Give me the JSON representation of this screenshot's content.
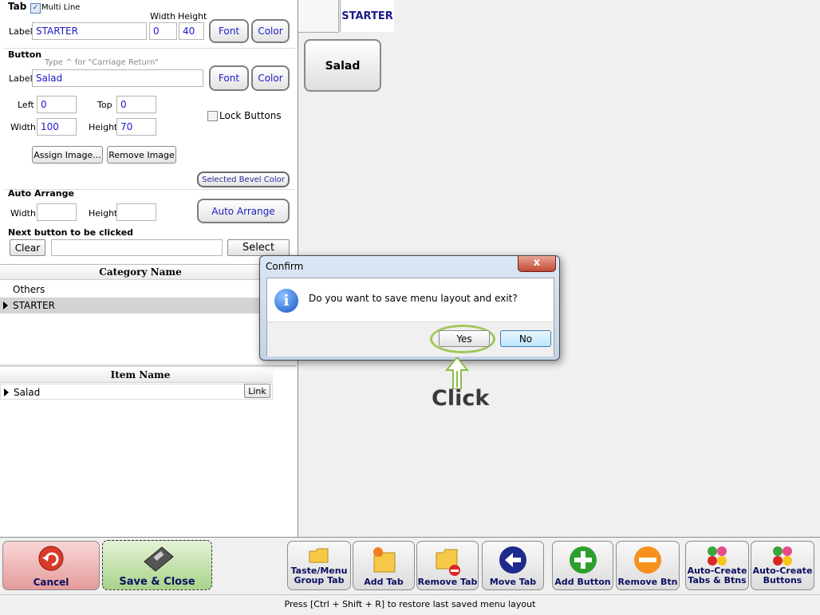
{
  "tab_section": {
    "heading": "Tab",
    "multiline_label": "Multi Line",
    "multiline_checked": true,
    "width_header": "Width",
    "height_header": "Height",
    "label_caption": "Label",
    "label_value": "STARTER",
    "width_value": "0",
    "height_value": "40",
    "font_btn": "Font",
    "color_btn": "Color"
  },
  "button_section": {
    "heading": "Button",
    "hint": "Type ^ for \"Carriage Return\"",
    "label_caption": "Label",
    "label_value": "Salad",
    "font_btn": "Font",
    "color_btn": "Color",
    "left_caption": "Left",
    "left_value": "0",
    "top_caption": "Top",
    "top_value": "0",
    "width_caption": "Width",
    "width_value": "100",
    "height_caption": "Height",
    "height_value": "70",
    "lock_label": "Lock Buttons",
    "assign_image": "Assign Image...",
    "remove_image": "Remove Image",
    "bevel_btn": "Selected Bevel Color"
  },
  "auto_arrange": {
    "heading": "Auto Arrange",
    "width_caption": "Width",
    "height_caption": "Height",
    "button": "Auto Arrange"
  },
  "next_button": {
    "heading": "Next button to be clicked",
    "clear": "Clear",
    "select": "Select"
  },
  "category_grid": {
    "header": "Category Name",
    "rows": [
      "Others",
      "STARTER"
    ]
  },
  "item_grid": {
    "header": "Item Name",
    "rows": [
      "Salad"
    ],
    "link_btn": "Link"
  },
  "preview": {
    "tab_label": "STARTER",
    "button_label": "Salad"
  },
  "dialog": {
    "title": "Confirm",
    "message": "Do you want to save menu layout and exit?",
    "yes": "Yes",
    "no": "No",
    "close_symbol": "x"
  },
  "annotation": {
    "text": "Click",
    "color": "#8bbd4a"
  },
  "toolbar": {
    "cancel": "Cancel",
    "save_close": "Save & Close",
    "taste_line1": "Taste/Menu",
    "taste_line2": "Group Tab",
    "add_tab": "Add Tab",
    "remove_tab": "Remove Tab",
    "move_tab": "Move Tab",
    "add_button": "Add Button",
    "remove_btn": "Remove Btn",
    "auto_tabs_line1": "Auto-Create",
    "auto_tabs_line2": "Tabs & Btns",
    "auto_btns_line1": "Auto-Create",
    "auto_btns_line2": "Buttons"
  },
  "status_bar": {
    "text": "Press [Ctrl + Shift + R] to restore last saved menu layout"
  }
}
